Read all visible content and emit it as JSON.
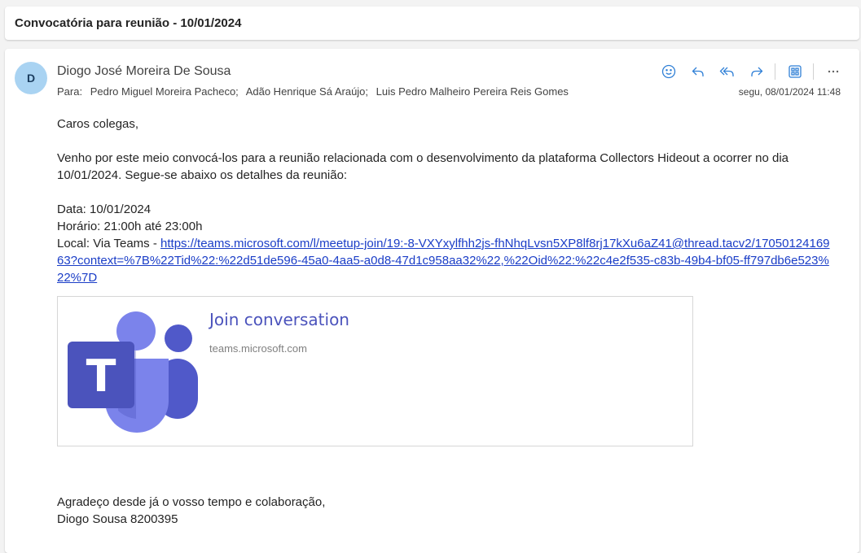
{
  "subject": "Convocatória para reunião - 10/01/2024",
  "sender": {
    "initial": "D",
    "name": "Diogo José Moreira De Sousa"
  },
  "recipients": {
    "label": "Para:",
    "list": [
      "Pedro Miguel Moreira Pacheco;",
      "Adão Henrique Sá Araújo;",
      "Luis Pedro Malheiro Pereira Reis Gomes"
    ]
  },
  "date": "segu, 08/01/2024 11:48",
  "toolbar": {
    "icons": [
      "emoji-icon",
      "reply-icon",
      "reply-all-icon",
      "forward-icon",
      "apps-icon",
      "more-icon"
    ],
    "accent": "#2f7fd6"
  },
  "body": {
    "greeting": "Caros colegas,",
    "intro": "Venho por este meio convocá-los para a reunião relacionada com o desenvolvimento da plataforma Collectors Hideout a ocorrer no dia 10/01/2024. Segue-se abaixo os detalhes da reunião:",
    "data_line": "Data: 10/01/2024",
    "horario_line": "Horário: 21:00h até 23:00h",
    "local_prefix": "Local: Via Teams - ",
    "link": "https://teams.microsoft.com/l/meetup-join/19:-8-VXYxylfhh2js-fhNhqLvsn5XP8lf8rj17kXu6aZ41@thread.tacv2/1705012416963?context=%7B%22Tid%22:%22d51de596-45a0-4aa5-a0d8-47d1c958aa32%22,%22Oid%22:%22c4e2f535-c83b-49b4-bf05-ff797db6e523%22%7D"
  },
  "preview": {
    "title": "Join conversation",
    "domain": "teams.microsoft.com",
    "logo_letter": "T",
    "color": "#4b53bc"
  },
  "closing": {
    "line1": "Agradeço desde já o vosso tempo e colaboração,",
    "line2": "Diogo Sousa 8200395"
  }
}
